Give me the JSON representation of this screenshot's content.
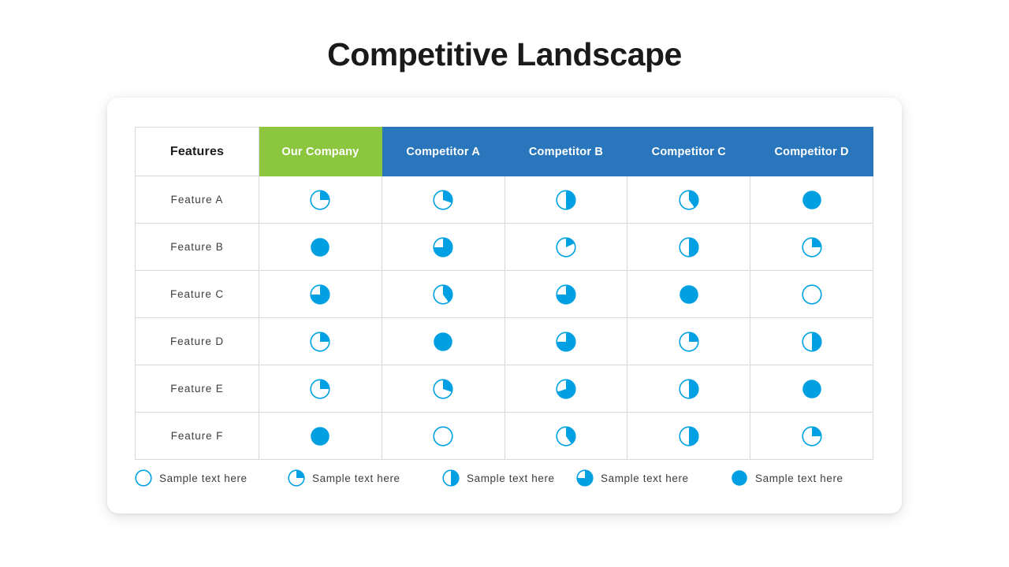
{
  "slide": {
    "title": "Competitive Landscape"
  },
  "colors": {
    "accent_blue": "#00A0E3",
    "header_blue": "#2A76BD",
    "header_green": "#8CC63E",
    "text_dark": "#1A1A1A",
    "border": "#D6D8DA"
  },
  "table": {
    "columns": [
      {
        "label": "Features",
        "style": "plain"
      },
      {
        "label": "Our Company",
        "style": "green"
      },
      {
        "label": "Competitor A",
        "style": "blue"
      },
      {
        "label": "Competitor B",
        "style": "blue"
      },
      {
        "label": "Competitor C",
        "style": "blue"
      },
      {
        "label": "Competitor D",
        "style": "blue"
      }
    ],
    "rows": [
      {
        "feature": "Feature A",
        "values": [
          25,
          30,
          50,
          40,
          100
        ]
      },
      {
        "feature": "Feature B",
        "values": [
          100,
          75,
          18,
          50,
          25
        ]
      },
      {
        "feature": "Feature C",
        "values": [
          75,
          40,
          75,
          100,
          0
        ]
      },
      {
        "feature": "Feature D",
        "values": [
          25,
          100,
          75,
          25,
          50
        ]
      },
      {
        "feature": "Feature E",
        "values": [
          25,
          30,
          70,
          50,
          100
        ]
      },
      {
        "feature": "Feature F",
        "values": [
          100,
          0,
          40,
          50,
          25
        ]
      }
    ]
  },
  "legend": {
    "items": [
      {
        "value": 0,
        "label": "Sample text here"
      },
      {
        "value": 25,
        "label": "Sample text here"
      },
      {
        "value": 50,
        "label": "Sample text here"
      },
      {
        "value": 75,
        "label": "Sample text here"
      },
      {
        "value": 100,
        "label": "Sample text here"
      }
    ]
  },
  "chart_data": {
    "type": "table",
    "title": "Competitive Landscape",
    "xlabel": "",
    "ylabel": "",
    "categories": [
      "Feature A",
      "Feature B",
      "Feature C",
      "Feature D",
      "Feature E",
      "Feature F"
    ],
    "series": [
      {
        "name": "Our Company",
        "values": [
          25,
          100,
          75,
          25,
          25,
          100
        ]
      },
      {
        "name": "Competitor A",
        "values": [
          30,
          75,
          40,
          100,
          30,
          0
        ]
      },
      {
        "name": "Competitor B",
        "values": [
          50,
          18,
          75,
          75,
          70,
          40
        ]
      },
      {
        "name": "Competitor C",
        "values": [
          40,
          50,
          100,
          25,
          50,
          50
        ]
      },
      {
        "name": "Competitor D",
        "values": [
          100,
          25,
          0,
          50,
          100,
          25
        ]
      }
    ],
    "legend_position": "bottom",
    "ylim": [
      0,
      100
    ],
    "notes": "Pie-fill glyphs encode coverage percent: 0, 25, 50, 75, 100"
  }
}
